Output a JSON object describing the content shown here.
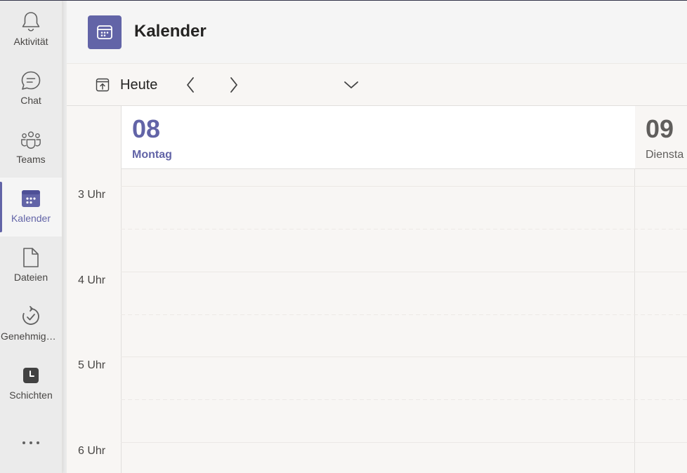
{
  "appbar": {
    "items": [
      {
        "label": "Aktivität",
        "icon": "bell-icon"
      },
      {
        "label": "Chat",
        "icon": "chat-icon"
      },
      {
        "label": "Teams",
        "icon": "teams-icon"
      },
      {
        "label": "Kalender",
        "icon": "calendar-icon",
        "active": true
      },
      {
        "label": "Dateien",
        "icon": "file-icon"
      },
      {
        "label": "Genehmigu…",
        "icon": "approvals-icon"
      },
      {
        "label": "Schichten",
        "icon": "shifts-icon"
      }
    ],
    "more_label": "•••"
  },
  "header": {
    "title": "Kalender",
    "icon": "calendar-icon"
  },
  "toolbar": {
    "today_label": "Heute"
  },
  "calendar": {
    "days": [
      {
        "number": "08",
        "name": "Montag",
        "selected": true
      },
      {
        "number": "09",
        "name": "Diensta",
        "selected": false
      }
    ],
    "times": [
      "3 Uhr",
      "4 Uhr",
      "5 Uhr",
      "6 Uhr"
    ]
  },
  "colors": {
    "accent": "#6264a7",
    "background": "#f5f5f5",
    "appbar": "#ebebeb"
  }
}
